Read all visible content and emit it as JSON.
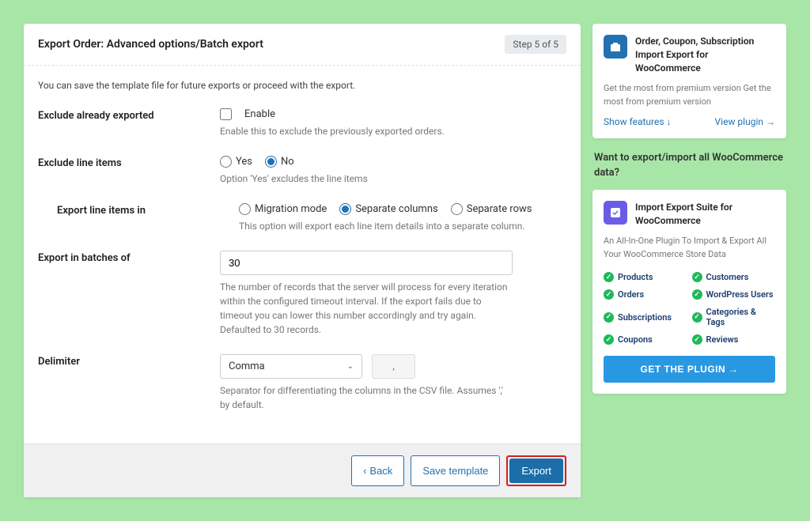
{
  "header": {
    "title": "Export Order: Advanced options/Batch export",
    "step": "Step 5 of 5"
  },
  "intro": "You can save the template file for future exports or proceed with the export.",
  "fields": {
    "exclude_exported": {
      "label": "Exclude already exported",
      "enable": "Enable",
      "help": "Enable this to exclude the previously exported orders."
    },
    "exclude_line": {
      "label": "Exclude line items",
      "yes": "Yes",
      "no": "No",
      "help": "Option 'Yes' excludes the line items"
    },
    "export_line": {
      "label": "Export line items in",
      "o1": "Migration mode",
      "o2": "Separate columns",
      "o3": "Separate rows",
      "help": "This option will export each line item details into a separate column."
    },
    "batches": {
      "label": "Export in batches of",
      "value": "30",
      "help": "The number of records that the server will process for every iteration within the configured timeout interval. If the export fails due to timeout you can lower this number accordingly and try again. Defaulted to 30 records."
    },
    "delimiter": {
      "label": "Delimiter",
      "value": "Comma",
      "preview": ",",
      "help": "Separator for differentiating the columns in the CSV file. Assumes ',' by default."
    }
  },
  "footer": {
    "back": "Back",
    "save": "Save template",
    "export": "Export"
  },
  "card1": {
    "title": "Order, Coupon, Subscription Import Export for WooCommerce",
    "desc": "Get the most from premium version Get the most from premium version",
    "show": "Show features",
    "view": "View plugin"
  },
  "promo": {
    "q": "Want to export/import all WooCommerce data?",
    "title": "Import Export Suite for WooCommerce",
    "desc": "An All-In-One Plugin To Import & Export All Your WooCommerce Store Data",
    "feats": [
      "Products",
      "Customers",
      "Orders",
      "WordPress Users",
      "Subscriptions",
      "Categories & Tags",
      "Coupons",
      "Reviews"
    ],
    "cta": "GET THE PLUGIN"
  }
}
